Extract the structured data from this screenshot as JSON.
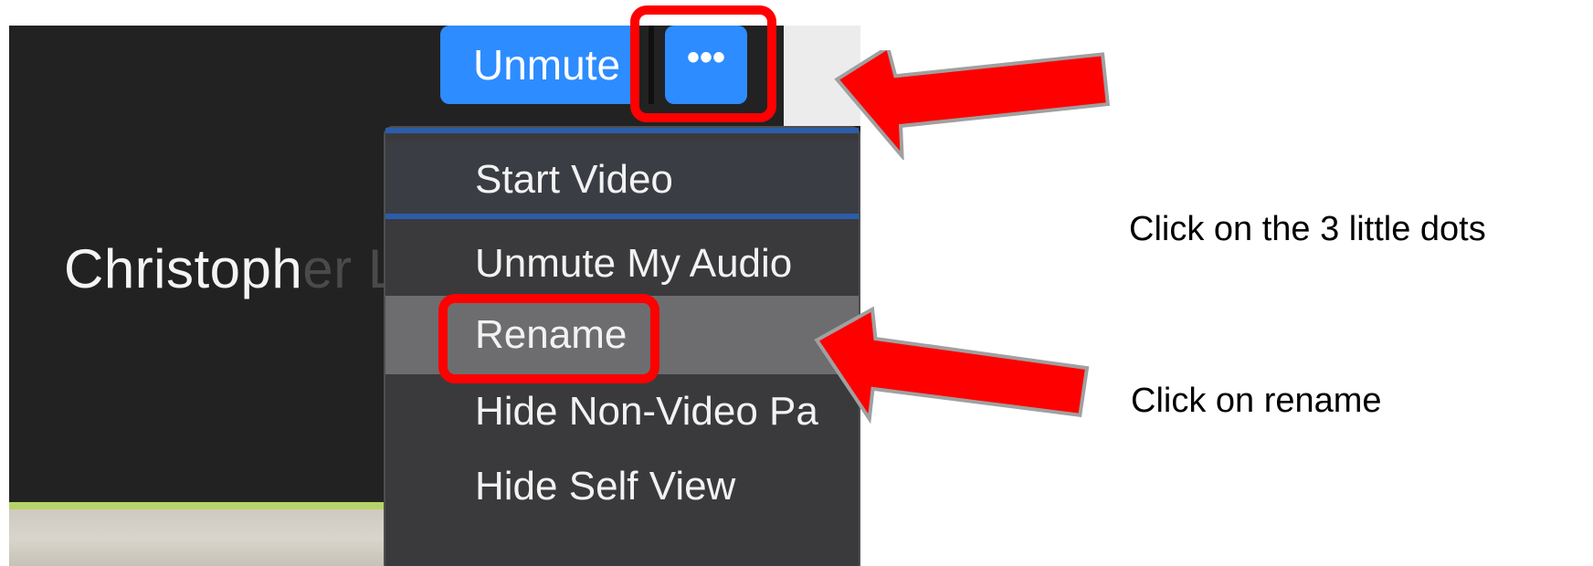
{
  "meeting": {
    "participant_name_start": "Christoph",
    "participant_name_end": "er Lim",
    "unmute_label": "Unmute",
    "more_label": "•••"
  },
  "menu": {
    "items": [
      {
        "label": "Start Video"
      },
      {
        "label": "Unmute My Audio"
      },
      {
        "label": "Rename"
      },
      {
        "label": "Hide Non-Video Pa"
      },
      {
        "label": "Hide Self View"
      }
    ]
  },
  "annotations": {
    "step1": "Click on the 3 little dots",
    "step2": "Click on rename",
    "highlight_color": "#ff0000"
  },
  "colors": {
    "accent_blue": "#2d8cff",
    "menu_bg": "#3a3a3c",
    "selected_bg": "#6d6d6f"
  }
}
